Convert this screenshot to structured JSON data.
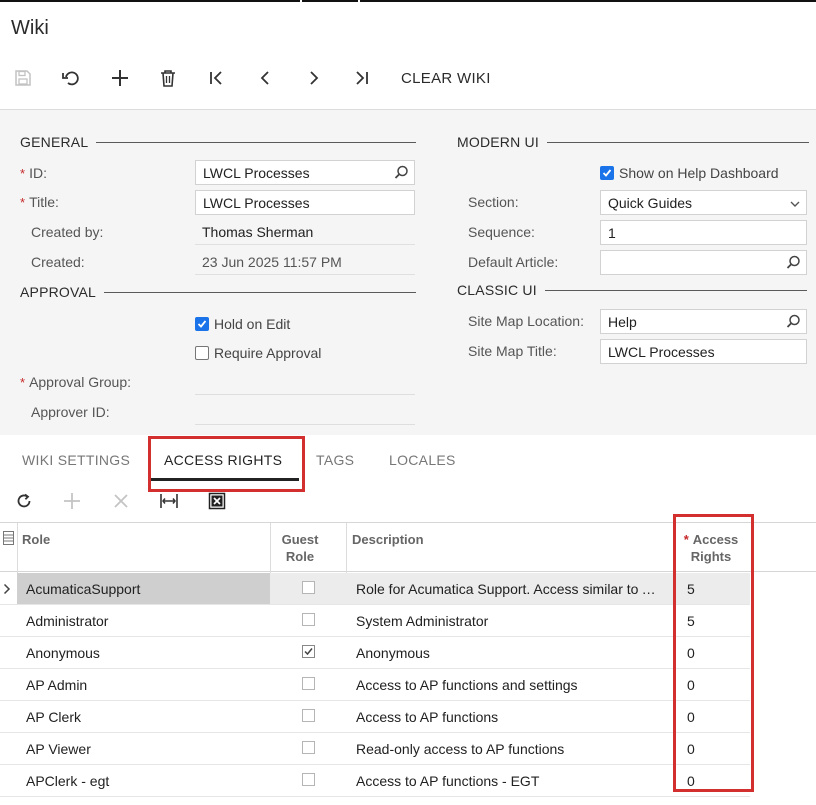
{
  "window": {
    "title": "Wiki"
  },
  "toolbar": {
    "icons": [
      "save-icon",
      "undo-icon",
      "add-icon",
      "delete-icon",
      "first-record-icon",
      "previous-record-icon",
      "next-record-icon",
      "last-record-icon"
    ],
    "clear_wiki_label": "CLEAR WIKI"
  },
  "general": {
    "heading": "GENERAL",
    "id_label": "ID:",
    "id_value": "LWCL Processes",
    "title_label": "Title:",
    "title_value": "LWCL Processes",
    "created_by_label": "Created by:",
    "created_by_value": "Thomas Sherman",
    "created_label": "Created:",
    "created_value": "23 Jun 2025 11:57 PM"
  },
  "approval": {
    "heading": "APPROVAL",
    "hold_on_edit_label": "Hold on Edit",
    "hold_on_edit_checked": true,
    "require_approval_label": "Require Approval",
    "require_approval_checked": false,
    "approval_group_label": "Approval Group:",
    "approval_group_value": "",
    "approver_id_label": "Approver ID:",
    "approver_id_value": ""
  },
  "modern_ui": {
    "heading": "MODERN UI",
    "show_on_help_label": "Show on Help Dashboard",
    "show_on_help_checked": true,
    "section_label": "Section:",
    "section_value": "Quick Guides",
    "sequence_label": "Sequence:",
    "sequence_value": "1",
    "default_article_label": "Default Article:",
    "default_article_value": ""
  },
  "classic_ui": {
    "heading": "CLASSIC UI",
    "site_map_location_label": "Site Map Location:",
    "site_map_location_value": "Help",
    "site_map_title_label": "Site Map Title:",
    "site_map_title_value": "LWCL Processes"
  },
  "tabs": [
    {
      "label": "WIKI SETTINGS",
      "active": false
    },
    {
      "label": "ACCESS RIGHTS",
      "active": true
    },
    {
      "label": "TAGS",
      "active": false
    },
    {
      "label": "LOCALES",
      "active": false
    }
  ],
  "grid": {
    "toolbar_icons": [
      "refresh-icon",
      "add-row-icon",
      "delete-row-icon",
      "fit-columns-icon",
      "excel-export-icon"
    ],
    "headers": {
      "role": "Role",
      "guest_role_1": "Guest",
      "guest_role_2": "Role",
      "description": "Description",
      "access_rights_1": "Access",
      "access_rights_2": "Rights"
    },
    "rows": [
      {
        "role": "AcumaticaSupport",
        "guest": false,
        "description": "Role for Acumatica Support. Access similar to Administrator",
        "access": "5",
        "selected": true
      },
      {
        "role": "Administrator",
        "guest": false,
        "description": "System Administrator",
        "access": "5",
        "selected": false
      },
      {
        "role": "Anonymous",
        "guest": true,
        "description": "Anonymous",
        "access": "0",
        "selected": false
      },
      {
        "role": "AP Admin",
        "guest": false,
        "description": "Access to AP functions and settings",
        "access": "0",
        "selected": false
      },
      {
        "role": "AP Clerk",
        "guest": false,
        "description": "Access to AP functions",
        "access": "0",
        "selected": false
      },
      {
        "role": "AP Viewer",
        "guest": false,
        "description": "Read-only access to AP functions",
        "access": "0",
        "selected": false
      },
      {
        "role": "APClerk - egt",
        "guest": false,
        "description": "Access to AP functions - EGT",
        "access": "0",
        "selected": false
      }
    ]
  },
  "colors": {
    "highlight_red": "#d32f2f",
    "checkbox_blue": "#1a73e8",
    "form_background": "#f5f5f5"
  }
}
